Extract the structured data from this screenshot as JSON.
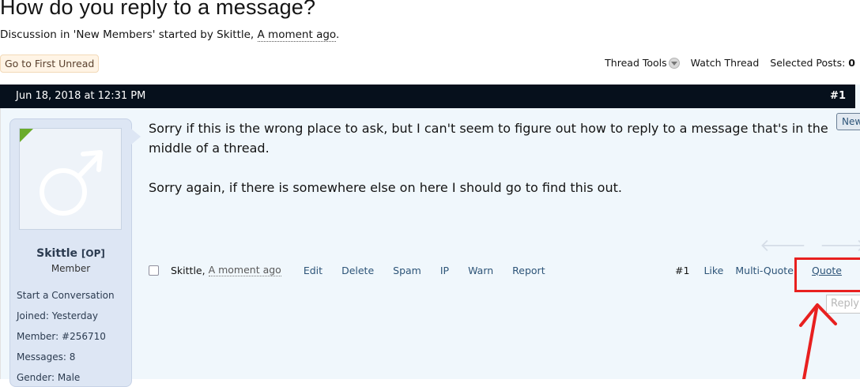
{
  "thread": {
    "title": "How do you reply to a message?",
    "desc_prefix": "Discussion in 'New Members' started by Skittle, ",
    "desc_time": "A moment ago",
    "desc_suffix": "."
  },
  "toolbar": {
    "first_unread": "Go to First Unread",
    "thread_tools": "Thread Tools",
    "watch_thread": "Watch Thread",
    "selected_posts_label": "Selected Posts:",
    "selected_posts_count": "0"
  },
  "post": {
    "date": "Jun 18, 2018 at 12:31 PM",
    "number": "#1",
    "badge_new": "New",
    "paragraphs": [
      "Sorry if this is the wrong place to ask, but I can't seem to figure out how to reply to a message that's in the middle of a thread.",
      "Sorry again, if there is somewhere else on here I should go to find this out."
    ],
    "prev_arrow": "🡐",
    "next_arrow": "🡒"
  },
  "user": {
    "name": "Skittle",
    "op_tag": "[OP]",
    "title": "Member",
    "start_conversation": "Start a Conversation",
    "joined_label": "Joined:",
    "joined_value": "Yesterday",
    "member_label": "Member:",
    "member_value": "#256710",
    "messages_label": "Messages:",
    "messages_value": "8",
    "gender_label": "Gender:",
    "gender_value": "Male"
  },
  "footer": {
    "author": "Skittle,",
    "time": "A moment ago",
    "edit": "Edit",
    "delete": "Delete",
    "spam": "Spam",
    "ip": "IP",
    "warn": "Warn",
    "report": "Report",
    "post_num": "#1",
    "like": "Like",
    "multi_quote": "Multi-Quote",
    "quote": "Quote",
    "reply_tooltip": "Reply"
  },
  "colors": {
    "header_bg": "#06101c",
    "link": "#2d5478",
    "annotation_red": "#e8201f",
    "online_green": "#6aab2a"
  }
}
